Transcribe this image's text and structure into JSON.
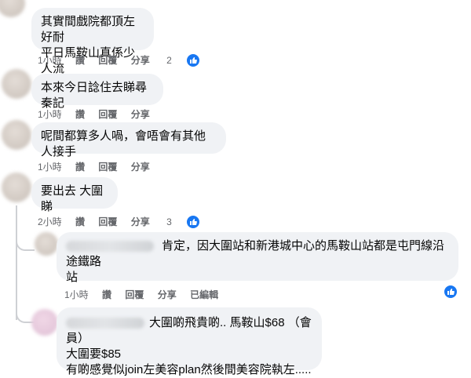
{
  "comments": [
    {
      "lines": [
        "其實間戲院都頂左好耐",
        "平日馬鞍山真係少人流"
      ],
      "time": "1小時",
      "like": "讚",
      "reply": "回覆",
      "share": "分享",
      "reactions": "2"
    },
    {
      "lines": [
        "本來今日諗住去睇尋秦記"
      ],
      "time": "1小時",
      "like": "讚",
      "reply": "回覆",
      "share": "分享"
    },
    {
      "lines": [
        "呢間都算多人喎，會唔會有其他人接手"
      ],
      "time": "1小時",
      "like": "讚",
      "reply": "回覆",
      "share": "分享"
    },
    {
      "lines": [
        "要出去 大圍睇"
      ],
      "time": "2小時",
      "like": "讚",
      "reply": "回覆",
      "share": "分享",
      "reactions": "3"
    }
  ],
  "replies": [
    {
      "lines": [
        "肯定，因大圍站和新港城中心的馬鞍山站都是屯門線沿途鐵路",
        "站"
      ],
      "time": "1小時",
      "like": "讚",
      "reply": "回覆",
      "share": "分享",
      "edited": "已編輯"
    },
    {
      "lines": [
        "大圍啲飛貴啲.. 馬鞍山$68 （會員）",
        "大圍要$85",
        "有啲感覺似join左美容plan然後間美容院執左....."
      ]
    }
  ],
  "icons": {
    "reaction": "like-icon"
  },
  "colors": {
    "bubble": "#f0f2f5",
    "meta": "#65676b",
    "like_blue": "#1877f2"
  }
}
